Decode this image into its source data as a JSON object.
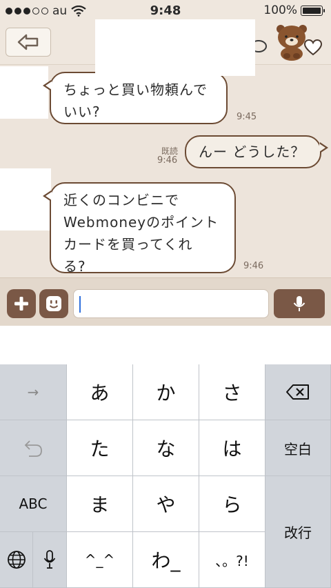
{
  "status": {
    "carrier": "au",
    "time": "9:48",
    "battery_text": "100%",
    "battery_level": 1.0,
    "signal_dots_filled": 3,
    "signal_dots_total": 5
  },
  "header": {
    "back_icon": "back-arrow-icon",
    "bear_icon": "brown-bear-sticker-icon",
    "favorite_icon": "heart-icon"
  },
  "messages": [
    {
      "side": "left",
      "text_line1": "ちょっと買い物頼んで",
      "text_line2": "いい?",
      "time": "9:45"
    },
    {
      "side": "right",
      "text": "んー どうした？",
      "read": "既読",
      "time": "9:46"
    },
    {
      "side": "left",
      "line1": "近くのコンビニで",
      "line2": "Webmoneyのポイント",
      "line3": "カードを買ってくれ",
      "line4": "る?",
      "time": "9:46"
    }
  ],
  "input": {
    "value": "",
    "plus_icon": "plus-icon",
    "emoji_icon": "emoji-face-icon",
    "mic_icon": "microphone-icon"
  },
  "keyboard": {
    "keys": {
      "next": "→",
      "a": "あ",
      "ka": "か",
      "sa": "さ",
      "undo": "undo-icon",
      "ta": "た",
      "na": "な",
      "ha": "は",
      "space": "空白",
      "abc": "ABC",
      "ma": "ま",
      "ya": "や",
      "ra": "ら",
      "enter": "改行",
      "globe": "globe-icon",
      "mic": "microphone-icon",
      "emoticon": "^_^",
      "wa": "わ_",
      "punct": "、。?!"
    }
  },
  "colors": {
    "chat_bg": "#ede4db",
    "bubble_border": "#6b4a33",
    "button_brown": "#7a5846",
    "keyboard_bg": "#d1d5db"
  }
}
